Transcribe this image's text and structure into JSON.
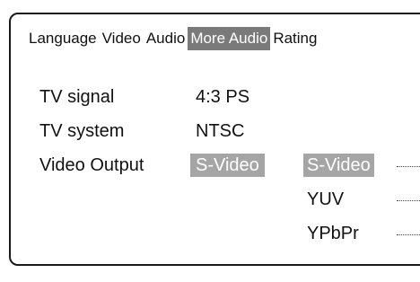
{
  "tabs": [
    {
      "label": "Language",
      "active": false
    },
    {
      "label": "Video",
      "active": false
    },
    {
      "label": "Audio",
      "active": false
    },
    {
      "label": "More Audio",
      "active": true
    },
    {
      "label": "Rating",
      "active": false
    }
  ],
  "settings": [
    {
      "label": "TV signal",
      "value": "4:3 PS"
    },
    {
      "label": "TV system",
      "value": "NTSC"
    },
    {
      "label": "Video Output",
      "value": "S-Video"
    }
  ],
  "video_output_options": [
    {
      "label": "S-Video",
      "selected": true
    },
    {
      "label": "YUV",
      "selected": false
    },
    {
      "label": "YPbPr",
      "selected": false
    }
  ],
  "colors": {
    "active_tab_bg": "#7a7a7a",
    "highlight_bg": "#a5a5a5",
    "highlight_text": "#ffffff"
  }
}
